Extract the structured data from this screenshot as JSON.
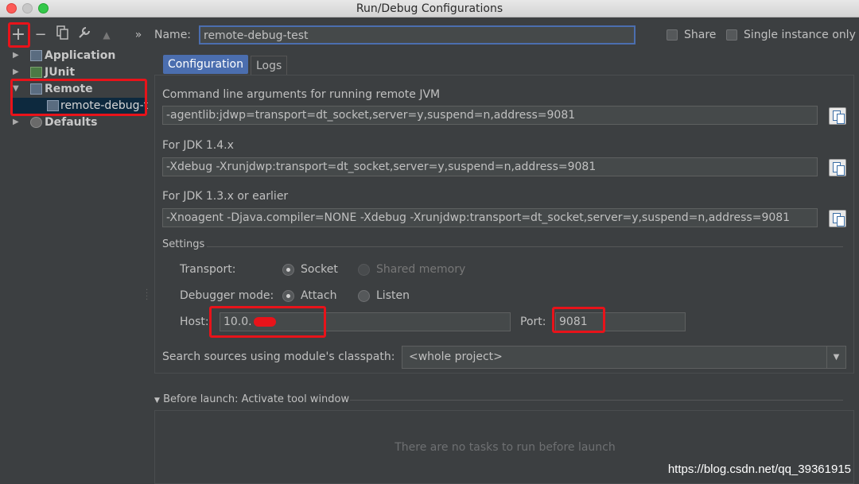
{
  "window": {
    "title": "Run/Debug Configurations"
  },
  "toolbar": {
    "add": "+",
    "remove": "−",
    "more": "»"
  },
  "tree": {
    "items": [
      {
        "label": "Application"
      },
      {
        "label": "JUnit"
      },
      {
        "label": "Remote"
      },
      {
        "label": "remote-debug-t"
      },
      {
        "label": "Defaults"
      }
    ]
  },
  "header": {
    "name_label": "Name:",
    "name_value": "remote-debug-test",
    "share_label": "Share",
    "single_instance_label": "Single instance only"
  },
  "tabs": [
    {
      "label": "Configuration"
    },
    {
      "label": "Logs"
    }
  ],
  "config": {
    "cmd_label": "Command line arguments for running remote JVM",
    "cmd_value": "-agentlib:jdwp=transport=dt_socket,server=y,suspend=n,address=9081",
    "jdk14_label": "For JDK 1.4.x",
    "jdk14_value": "-Xdebug -Xrunjdwp:transport=dt_socket,server=y,suspend=n,address=9081",
    "jdk13_label": "For JDK 1.3.x or earlier",
    "jdk13_value": "-Xnoagent -Djava.compiler=NONE -Xdebug -Xrunjdwp:transport=dt_socket,server=y,suspend=n,address=9081",
    "settings_label": "Settings",
    "transport_label": "Transport:",
    "socket_label": "Socket",
    "shared_memory_label": "Shared memory",
    "debugger_mode_label": "Debugger mode:",
    "attach_label": "Attach",
    "listen_label": "Listen",
    "host_label": "Host:",
    "host_value": "10.0.",
    "port_label": "Port:",
    "port_value": "9081",
    "classpath_label": "Search sources using module's classpath:",
    "classpath_value": "<whole project>"
  },
  "before_launch": {
    "label": "Before launch: Activate tool window",
    "empty_text": "There are no tasks to run before launch"
  },
  "watermark": "https://blog.csdn.net/qq_39361915",
  "colors": {
    "highlight": "#e8131a",
    "accent": "#4b6eaf",
    "selection": "#0d293e"
  }
}
